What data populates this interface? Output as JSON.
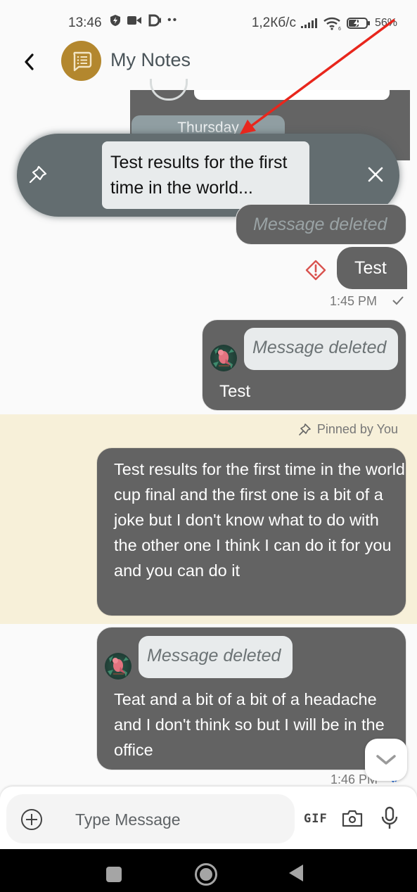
{
  "status_bar": {
    "time": "13:46",
    "network_speed": "1,2Кб/с",
    "battery": "56%",
    "icons": [
      "shield-icon",
      "video-icon",
      "d-icon",
      "more-dots-icon",
      "signal-icon",
      "wifi-icon",
      "battery-charging-icon"
    ]
  },
  "header": {
    "back_icon": "chevron-left-icon",
    "avatar_icon": "notes-chat-icon",
    "avatar_color": "#b3872e",
    "title": "My Notes"
  },
  "day_separator": "Thursday",
  "pinned_banner": {
    "pin_icon": "unpin-icon",
    "preview": "Test results for the first time in the world...",
    "close_icon": "close-icon"
  },
  "annotation": {
    "type": "red-arrow",
    "color": "#e8261c"
  },
  "messages": [
    {
      "id": "m1",
      "deleted_label": "Message deleted"
    },
    {
      "id": "m2",
      "text": "Test",
      "error_icon": "warning-diamond-icon",
      "error_color": "#d9534f",
      "time": "1:45 PM",
      "status": "sent"
    },
    {
      "id": "m3",
      "quote": "Message deleted",
      "text": "Test"
    },
    {
      "id": "m4",
      "pinned_label": "Pinned by You",
      "text": "Test results for the first time in the world cup final and the first one is a bit of a joke but I don't know what to do with the other one I think I can do it for you and you can do it"
    },
    {
      "id": "m5",
      "quote": "Message deleted",
      "text": "Teat and a bit of a bit of a headache and I don't think so but I will be in the office",
      "time": "1:46 PM",
      "status": "read"
    }
  ],
  "composer": {
    "placeholder": "Type Message",
    "value": "",
    "gif_label": "GIF"
  },
  "colors": {
    "bubble": "#636363",
    "pinned_highlight": "#f7f0d9",
    "read_tick": "#2d6fd6"
  }
}
